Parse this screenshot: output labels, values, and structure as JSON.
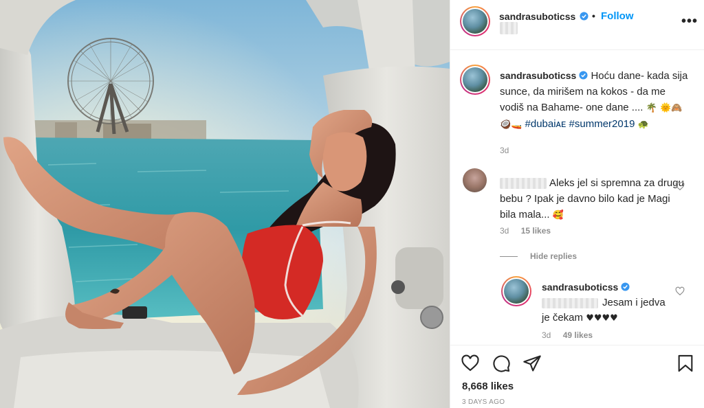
{
  "header": {
    "username": "sandrasuboticss",
    "separator": "•",
    "follow_label": "Follow",
    "more_label": "•••"
  },
  "caption": {
    "username": "sandrasuboticss",
    "text": "Hoću dane- kada sija sunce, da mirišem na kokos - da me vodiš na Bahame- one dane .... ",
    "emojis_1": "🌴",
    "emojis_2": "🌞🙈🥥🚤 ",
    "hashtag_1": "#dubaiᴀᴇ",
    "hashtag_2": "#summer2019",
    "emojis_3": "🐢",
    "time": "3d"
  },
  "comment": {
    "text": "Aleks jel si spremna za drugu bebu ? Ipak je davno bilo kad je Magi bila mala... ",
    "emoji": "🥰",
    "time": "3d",
    "likes": "15 likes"
  },
  "hide_replies_label": "Hide replies",
  "reply": {
    "username": "sandrasuboticss",
    "text": "Jesam i jedva je čekam ",
    "hearts": "♥♥♥♥",
    "time": "3d",
    "likes": "49 likes"
  },
  "footer": {
    "likes_total": "8,668 likes",
    "posted": "3 DAYS AGO"
  },
  "colors": {
    "link": "#0095f6",
    "hashtag": "#00376b",
    "muted": "#8e8e8e",
    "verified": "#3897f0"
  },
  "icons": [
    "verified-badge-icon",
    "more-options-icon",
    "like-heart-icon",
    "comment-icon",
    "share-icon",
    "save-bookmark-icon"
  ]
}
